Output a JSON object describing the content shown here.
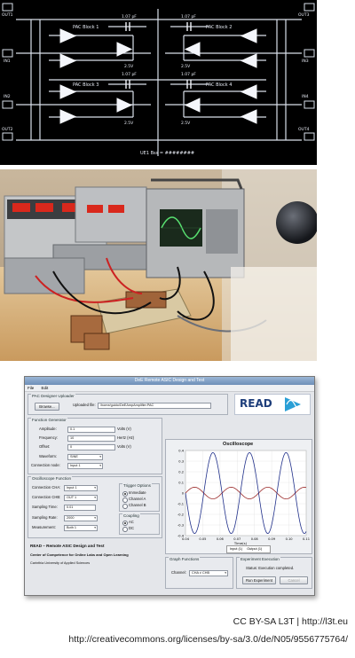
{
  "schematic": {
    "blocks": [
      "PAC Block 1",
      "PAC Block 2",
      "PAC Block 3",
      "PAC Block 4"
    ],
    "cap_labels": [
      "1.07 pF",
      "1.07 pF",
      "1.07 pF",
      "1.07 pF"
    ],
    "volt_labels": [
      "2.5V",
      "2.5V",
      "2.5V",
      "2.5V"
    ],
    "left_ports": [
      "OUT1",
      "IN1",
      "IN2",
      "OUT2"
    ],
    "right_ports": [
      "OUT3",
      "IN3",
      "IN4",
      "OUT4"
    ],
    "footer": "UE1 Bss = ########"
  },
  "app": {
    "title": "DeE Remote ASIC Design and Test",
    "menu": [
      "File",
      "Edit"
    ],
    "uploader": {
      "title": "PAC Designer Uploader",
      "browse_label": "Browse...",
      "uploaded_file_label": "Uploaded file:",
      "uploaded_file_value": "/home/guido/DeEAmpAmplifier.PAC"
    },
    "logo": {
      "text": "READ"
    },
    "function_generator": {
      "title": "Function Generator",
      "fields": [
        {
          "label": "Amplitude:",
          "value": "0.1",
          "unit": "Volts (V)"
        },
        {
          "label": "Frequency:",
          "value": "10",
          "unit": "Hertz (Hz)"
        },
        {
          "label": "Offset:",
          "value": "0",
          "unit": "Volts (V)"
        }
      ],
      "waveform_label": "Waveform:",
      "waveform_value": "SINE",
      "connection_label": "Connection node:",
      "connection_value": "Input 1"
    },
    "oscilloscope_function": {
      "title": "Oscilloscope Function",
      "cha_label": "Connection CHA:",
      "cha_value": "Input 1",
      "chb_label": "Connection CHB:",
      "chb_value": "OUT 1",
      "time_label": "Sampling Time:",
      "time_value": "0.01",
      "rate_label": "Sampling Rate:",
      "rate_value": "2000",
      "measure_label": "Measurement:",
      "measure_value": "Both 1",
      "trigger_title": "Trigger Options",
      "trigger_options": [
        "Immediate",
        "Channel A",
        "Channel B"
      ],
      "coupling_title": "Coupling",
      "coupling_options": [
        "AC",
        "DC"
      ]
    },
    "oscilloscope": {
      "title": "Oscilloscope",
      "y_ticks": [
        "0.4",
        "0.3",
        "0.2",
        "0.1",
        "0",
        "-0.1",
        "-0.2",
        "-0.3",
        "-0.4"
      ],
      "x_ticks": [
        "0.04",
        "0.05",
        "0.06",
        "0.07",
        "0.08",
        "0.09",
        "0.10",
        "0.11"
      ],
      "xlabel": "Time(s)",
      "legend": [
        "Input (1)",
        "Output (1)"
      ]
    },
    "graph_functions": {
      "title": "Graph Functions",
      "channel_label": "Channel:",
      "channel_value": "CHA ≠ CHB"
    },
    "experiment_execution": {
      "title": "Experiment Execution",
      "status": "Status: Execution completed.",
      "run_label": "Run Experiment",
      "cancel_label": "Cancel"
    },
    "footer": {
      "line1": "READ – Remote ASIC Design and Test",
      "line2": "Center of Competence for Online Labs and Open Learning",
      "line3": "Carinthia University of Applied Sciences"
    }
  },
  "credits": {
    "license": "CC BY-SA L3T | http://l3t.eu",
    "url": "http://creativecommons.org/licenses/by-sa/3.0/de/N05/9556775764/"
  }
}
